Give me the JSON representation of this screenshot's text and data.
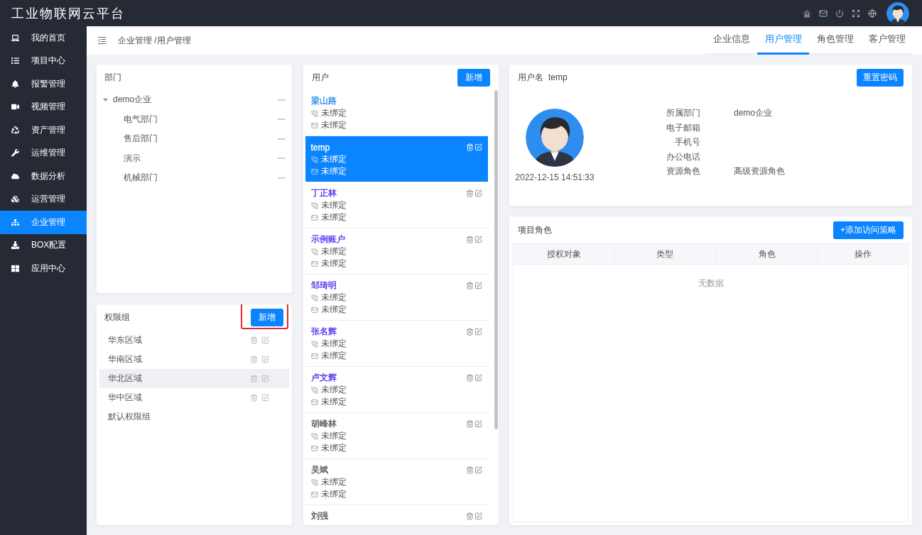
{
  "app": {
    "title": "工业物联网云平台"
  },
  "sidebar": {
    "items": [
      {
        "label": "我的首页",
        "selected": false
      },
      {
        "label": "项目中心",
        "selected": false
      },
      {
        "label": "报警管理",
        "selected": false
      },
      {
        "label": "视频管理",
        "selected": false
      },
      {
        "label": "资产管理",
        "selected": false
      },
      {
        "label": "运维管理",
        "selected": false
      },
      {
        "label": "数据分析",
        "selected": false
      },
      {
        "label": "运营管理",
        "selected": false
      },
      {
        "label": "企业管理",
        "selected": true
      },
      {
        "label": "BOX配置",
        "selected": false
      },
      {
        "label": "应用中心",
        "selected": false
      }
    ]
  },
  "header": {
    "breadcrumb": "企业管理 /用户管理",
    "tabs": [
      {
        "label": "企业信息",
        "selected": false
      },
      {
        "label": "用户管理",
        "selected": true
      },
      {
        "label": "角色管理",
        "selected": false
      },
      {
        "label": "客户管理",
        "selected": false
      }
    ]
  },
  "departments": {
    "title": "部门",
    "tree": [
      {
        "label": "demo企业",
        "expanded": true,
        "children": [
          {
            "label": "电气部门"
          },
          {
            "label": "售后部门"
          },
          {
            "label": "演示"
          },
          {
            "label": "机械部门"
          }
        ]
      }
    ]
  },
  "permission_groups": {
    "title": "权限组",
    "add_button": {
      "label": "新增",
      "highlighted": true
    },
    "items": [
      {
        "label": "华东区域",
        "selected": false,
        "editable": true
      },
      {
        "label": "华南区域",
        "selected": false,
        "editable": true
      },
      {
        "label": "华北区域",
        "selected": true,
        "editable": true
      },
      {
        "label": "华中区域",
        "selected": false,
        "editable": true
      },
      {
        "label": "默认权限组",
        "selected": false,
        "editable": false
      }
    ]
  },
  "users": {
    "title": "用户",
    "add_button": "新增",
    "items": [
      {
        "name": "梁山路",
        "color": "#2d8cf0",
        "selected": false,
        "actions": false,
        "contacts": [
          {
            "kind": "phone",
            "text": "未绑定"
          },
          {
            "kind": "email",
            "text": "未绑定"
          }
        ]
      },
      {
        "name": "temp",
        "selected": true,
        "actions": true,
        "contacts": [
          {
            "kind": "phone",
            "text": "未绑定"
          },
          {
            "kind": "email",
            "text": "未绑定"
          }
        ]
      },
      {
        "name": "丁正林",
        "color": "#4a2ff0",
        "selected": false,
        "actions": true,
        "contacts": [
          {
            "kind": "phone",
            "text": "未绑定"
          },
          {
            "kind": "email",
            "text": "未绑定"
          }
        ]
      },
      {
        "name": "示例账户",
        "color": "#4a2ff0",
        "selected": false,
        "actions": true,
        "contacts": [
          {
            "kind": "phone",
            "text": "未绑定"
          },
          {
            "kind": "email",
            "text": "未绑定"
          }
        ]
      },
      {
        "name": "邹琦明",
        "color": "#4a2ff0",
        "selected": false,
        "actions": true,
        "contacts": [
          {
            "kind": "phone",
            "text": "未绑定"
          },
          {
            "kind": "email",
            "text": "未绑定"
          }
        ]
      },
      {
        "name": "张名辉",
        "color": "#4a2ff0",
        "selected": false,
        "actions": true,
        "contacts": [
          {
            "kind": "phone",
            "text": "未绑定"
          },
          {
            "kind": "email",
            "text": "未绑定"
          }
        ]
      },
      {
        "name": "卢文辉",
        "color": "#4a2ff0",
        "selected": false,
        "actions": true,
        "contacts": [
          {
            "kind": "phone",
            "text": "未绑定"
          },
          {
            "kind": "email",
            "text": "未绑定"
          }
        ]
      },
      {
        "name": "胡峰林",
        "color": "#555555",
        "selected": false,
        "actions": true,
        "contacts": [
          {
            "kind": "phone",
            "text": "未绑定"
          },
          {
            "kind": "email",
            "text": "未绑定"
          }
        ]
      },
      {
        "name": "吴斌",
        "color": "#555555",
        "selected": false,
        "actions": true,
        "contacts": [
          {
            "kind": "phone",
            "text": "未绑定"
          },
          {
            "kind": "email",
            "text": "未绑定"
          }
        ]
      },
      {
        "name": "刘强",
        "color": "#555555",
        "selected": false,
        "actions": true
      }
    ]
  },
  "user_detail": {
    "username_label": "用户名",
    "username": "temp",
    "reset_button": "重置密码",
    "created_at": "2022-12-15 14:51:33",
    "fields": [
      {
        "label": "所属部门",
        "value": "demo企业"
      },
      {
        "label": "电子邮箱"
      },
      {
        "label": "手机号"
      },
      {
        "label": "办公电话"
      },
      {
        "label": "资源角色",
        "value": "高级资源角色"
      }
    ]
  },
  "project_roles": {
    "title": "项目角色",
    "add_button": "+添加访问策略",
    "columns": [
      "授权对象",
      "类型",
      "角色",
      "操作"
    ],
    "empty_text": "无数据"
  }
}
